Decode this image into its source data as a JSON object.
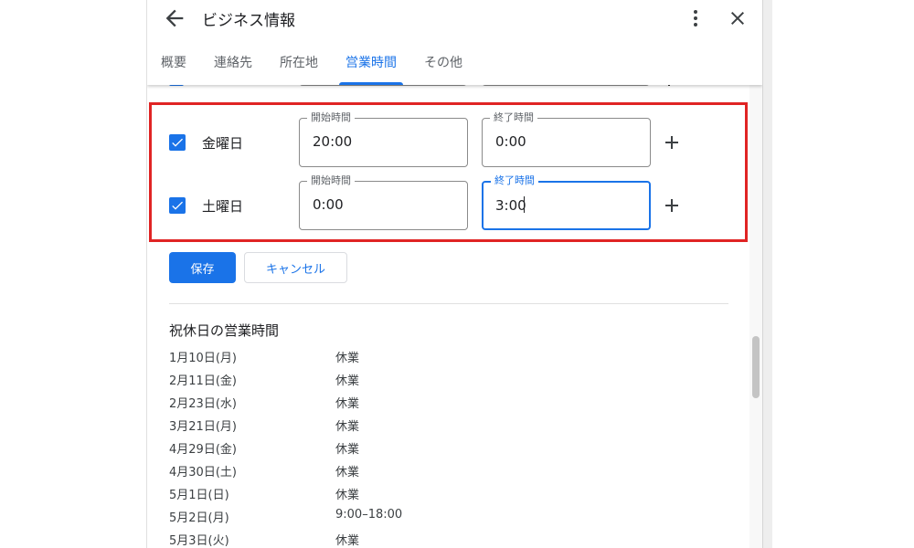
{
  "header": {
    "title": "ビジネス情報",
    "tabs": [
      {
        "label": "概要",
        "active": false
      },
      {
        "label": "連絡先",
        "active": false
      },
      {
        "label": "所在地",
        "active": false
      },
      {
        "label": "営業時間",
        "active": true
      },
      {
        "label": "その他",
        "active": false
      }
    ]
  },
  "hours": {
    "rows": [
      {
        "day": "金曜日",
        "checked": true,
        "open": {
          "label": "開始時間",
          "value": "20:00"
        },
        "close": {
          "label": "終了時間",
          "value": "0:00"
        }
      },
      {
        "day": "土曜日",
        "checked": true,
        "open": {
          "label": "開始時間",
          "value": "0:00"
        },
        "close": {
          "label": "終了時間",
          "value": "3:00",
          "focused": true
        }
      }
    ]
  },
  "actions": {
    "save_label": "保存",
    "cancel_label": "キャンセル"
  },
  "holidays": {
    "title": "祝休日の営業時間",
    "items": [
      {
        "date": "1月10日(月)",
        "status": "休業"
      },
      {
        "date": "2月11日(金)",
        "status": "休業"
      },
      {
        "date": "2月23日(水)",
        "status": "休業"
      },
      {
        "date": "3月21日(月)",
        "status": "休業"
      },
      {
        "date": "4月29日(金)",
        "status": "休業"
      },
      {
        "date": "4月30日(土)",
        "status": "休業"
      },
      {
        "date": "5月1日(日)",
        "status": "休業"
      },
      {
        "date": "5月2日(月)",
        "status": "9:00–18:00"
      },
      {
        "date": "5月3日(火)",
        "status": "休業"
      }
    ]
  },
  "colors": {
    "accent": "#1a73e8",
    "highlight": "#e02424"
  }
}
